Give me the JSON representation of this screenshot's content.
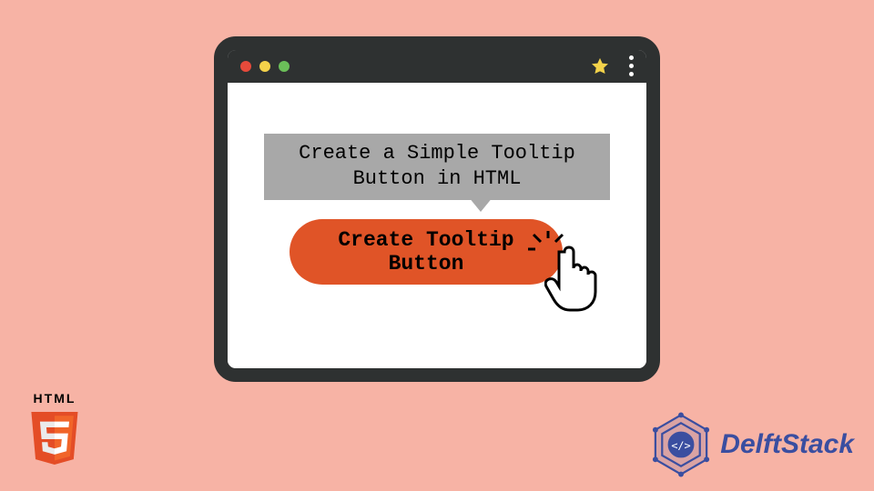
{
  "tooltip": {
    "text": "Create a Simple Tooltip Button in HTML"
  },
  "button": {
    "label": "Create Tooltip Button"
  },
  "logos": {
    "html5_label": "HTML",
    "delftstack_label": "DelftStack"
  },
  "colors": {
    "background": "#f7b3a5",
    "window_chrome": "#2e3131",
    "tooltip_bg": "#a8a8a8",
    "button_bg": "#e05427",
    "html5_orange": "#e44d26",
    "delft_blue": "#3a4ea0"
  }
}
